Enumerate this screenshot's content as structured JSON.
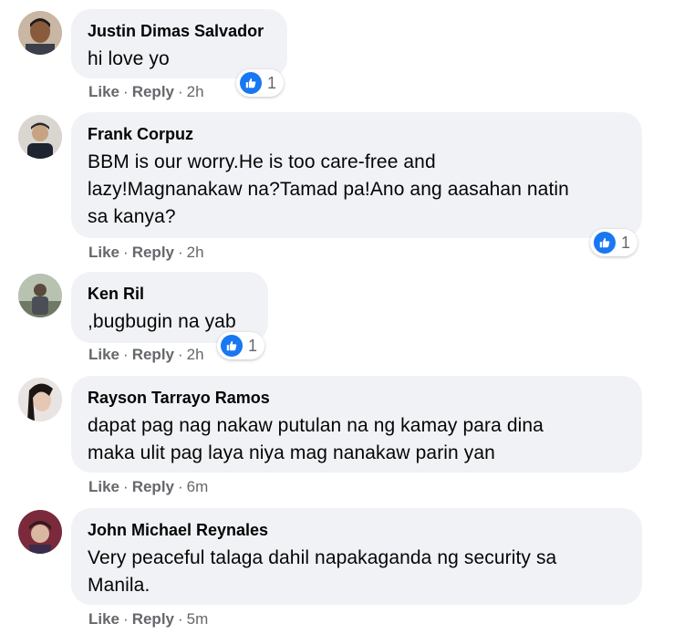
{
  "comments": [
    {
      "author": "Justin Dimas Salvador",
      "lines": [
        "hi love yo"
      ],
      "like": "Like",
      "reply": "Reply",
      "time": "2h",
      "reaction_count": "1"
    },
    {
      "author": "Frank Corpuz",
      "lines": [
        "BBM is our worry.He is too care-free and",
        "lazy!Magnanakaw na?Tamad pa!Ano ang aasahan natin",
        "sa kanya?"
      ],
      "like": "Like",
      "reply": "Reply",
      "time": "2h",
      "reaction_count": "1"
    },
    {
      "author": "Ken Ril",
      "lines": [
        ",bugbugin na yab"
      ],
      "like": "Like",
      "reply": "Reply",
      "time": "2h",
      "reaction_count": "1"
    },
    {
      "author": "Rayson Tarrayo Ramos",
      "lines": [
        "dapat pag nag nakaw putulan na ng kamay para dina",
        "maka ulit pag laya niya mag nanakaw parin yan"
      ],
      "like": "Like",
      "reply": "Reply",
      "time": "6m"
    },
    {
      "author": "John Michael Reynales",
      "lines": [
        "Very peaceful talaga dahil napakaganda ng security sa",
        "Manila."
      ],
      "like": "Like",
      "reply": "Reply",
      "time": "5m"
    }
  ],
  "separator": "·",
  "colors": {
    "bubble": "#f0f2f5",
    "like_blue": "#1877f2",
    "meta_gray": "#65676b"
  },
  "icons": {
    "reaction": "thumbs-up-icon"
  }
}
